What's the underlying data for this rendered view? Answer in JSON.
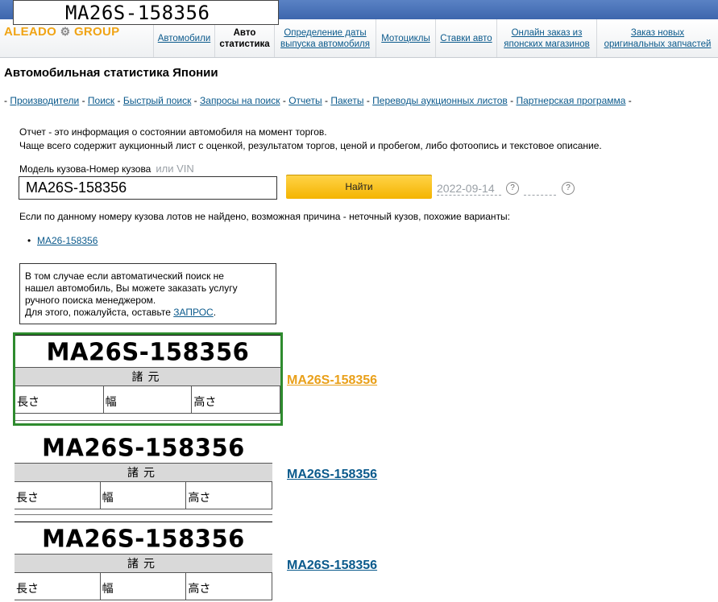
{
  "search_overlay": "MA26S-158356",
  "logo": {
    "left": "ALEADO",
    "right": "GROUP"
  },
  "nav": [
    {
      "label": "Автомобили"
    },
    {
      "label": "Авто статистика"
    },
    {
      "label": "Определение даты выпуска автомобиля"
    },
    {
      "label": "Мотоциклы"
    },
    {
      "label": "Ставки авто"
    },
    {
      "label": "Онлайн заказ из японских магазинов"
    },
    {
      "label": "Заказ новых оригинальных запчастей"
    }
  ],
  "page": {
    "title": "Автомобильная статистика Японии"
  },
  "subnav": [
    "Производители",
    "Поиск",
    "Быстрый поиск",
    "Запросы на поиск",
    "Отчеты",
    "Пакеты",
    "Переводы аукционных листов",
    "Партнерская программа"
  ],
  "info": {
    "line1": "Отчет - это информация о состоянии автомобиля на момент торгов.",
    "line2": "Чаще всего содержит аукционный лист с оценкой, результатом торгов, ценой и пробегом, либо фотоопись и текстовое описание."
  },
  "form": {
    "label": "Модель кузова-Номер кузова",
    "label_alt": "или VIN",
    "query_value": "MA26S-158356",
    "find_label": "Найти",
    "date": "2022-09-14",
    "help_icon": "?"
  },
  "not_found": "Если по данному номеру кузова лотов не найдено, возможная причина - неточный кузов, похожие варианты:",
  "variants": [
    "MA26-158356"
  ],
  "manual": {
    "line1": "В том случае если автоматический поиск не",
    "line2": "нашел автомобиль, Вы можете заказать услугу",
    "line3": "ручного поиска менеджером.",
    "line4": "Для этого, пожалуйста, оставьте",
    "link": "ЗАПРОС",
    "end": "."
  },
  "results": [
    {
      "plate": "MA26S-158356",
      "spec": "諸元",
      "cells": [
        "長さ",
        "幅",
        "高さ"
      ],
      "link": "MA26S-158356"
    },
    {
      "plate": "MA26S-158356",
      "spec": "諸元",
      "cells": [
        "長さ",
        "幅",
        "高さ"
      ],
      "link": "MA26S-158356"
    },
    {
      "plate": "MA26S-158356",
      "spec": "諸元",
      "cells": [
        "長さ",
        "幅",
        "高さ"
      ],
      "link": "MA26S-158356"
    }
  ],
  "colors": {
    "accent": "#f4b400",
    "link": "#0b5a8c",
    "highlight_border": "#2e8b2e",
    "active_link": "#e9a01a"
  }
}
